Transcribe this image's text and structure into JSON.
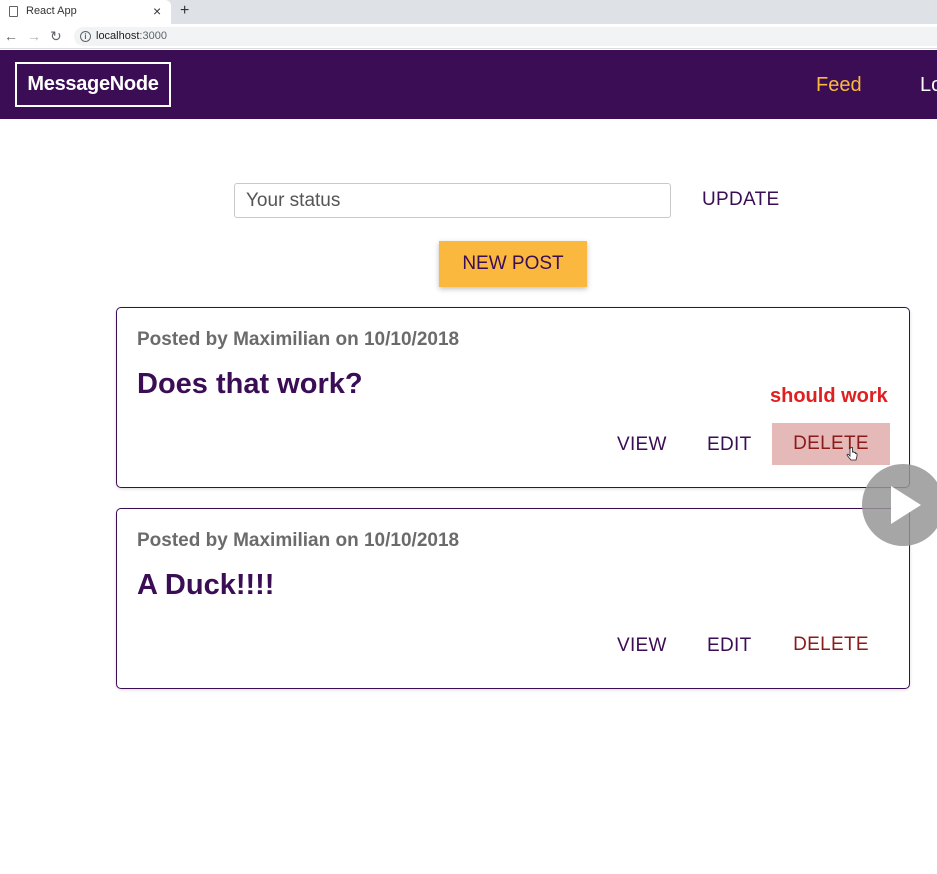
{
  "browser": {
    "tab_title": "React App",
    "tab_close": "×",
    "new_tab": "+",
    "url_host": "localhost",
    "url_port": ":3000"
  },
  "header": {
    "logo": "MessageNode",
    "nav": {
      "feed": "Feed",
      "logout": "Lo"
    }
  },
  "status": {
    "placeholder": "Your status",
    "update_label": "UPDATE"
  },
  "new_post_label": "NEW POST",
  "posts": [
    {
      "meta": "Posted by Maximilian on 10/10/2018",
      "title": "Does that work?",
      "actions": {
        "view": "VIEW",
        "edit": "EDIT",
        "delete": "DELETE"
      }
    },
    {
      "meta": "Posted by Maximilian on 10/10/2018",
      "title": "A Duck!!!!",
      "actions": {
        "view": "VIEW",
        "edit": "EDIT",
        "delete": "DELETE"
      }
    }
  ],
  "annotation": "should work",
  "colors": {
    "brand": "#3b0d55",
    "accent": "#fab83f",
    "danger": "#8b1a1a",
    "annotation": "#e02020"
  },
  "icons": {
    "favicon": "page-icon",
    "back": "arrow-left-icon",
    "forward": "arrow-right-icon",
    "reload": "reload-icon",
    "info": "info-icon",
    "cursor": "hand-cursor-icon",
    "play": "play-icon"
  }
}
